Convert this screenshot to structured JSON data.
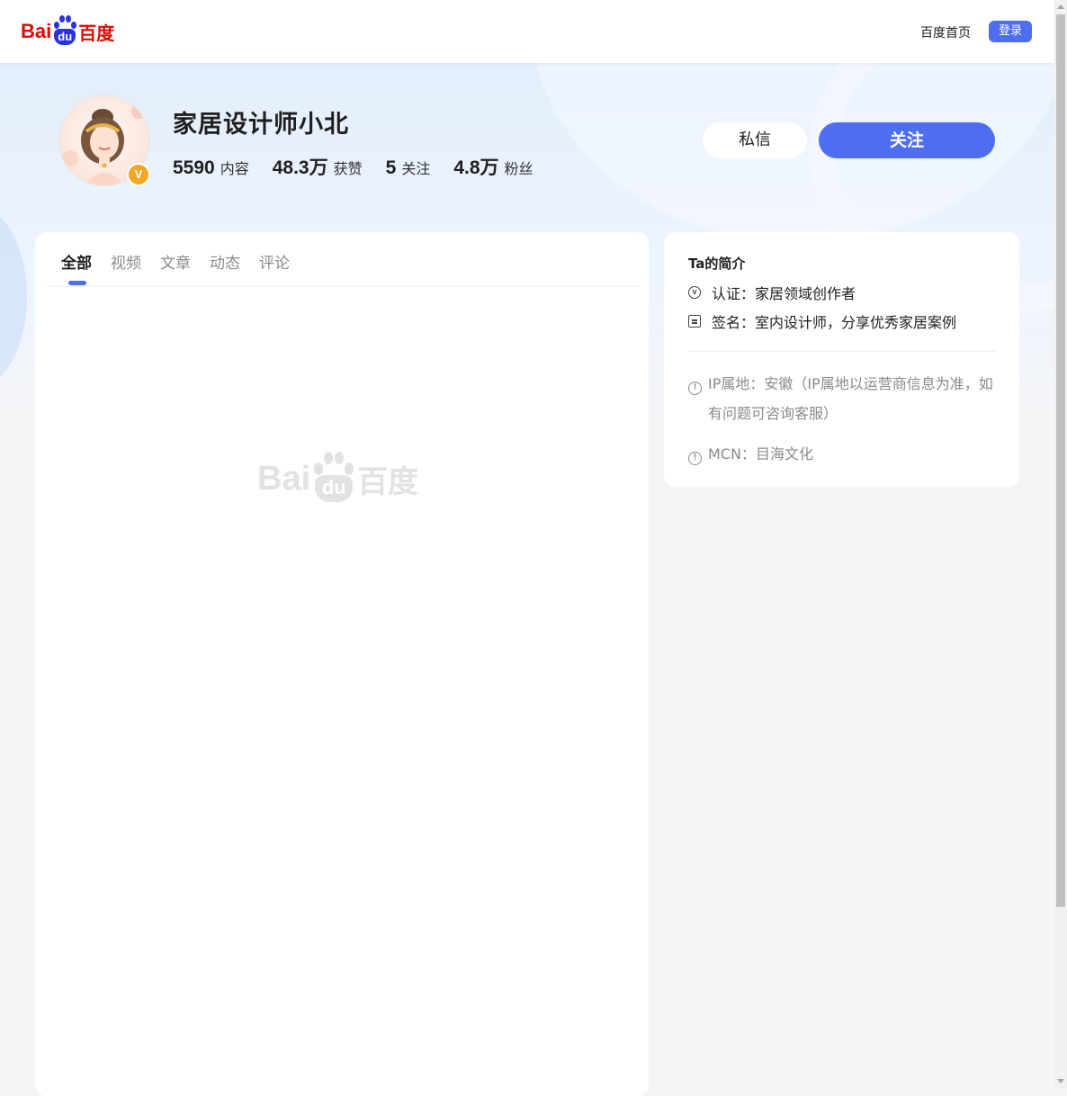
{
  "header": {
    "logo_bai": "Bai",
    "logo_du": "du",
    "logo_cn": "百度",
    "home_link": "百度首页",
    "login_label": "登录"
  },
  "profile": {
    "name": "家居设计师小北",
    "verify_mark": "V",
    "stats": [
      {
        "value": "5590",
        "label": "内容"
      },
      {
        "value": "48.3万",
        "label": "获赞"
      },
      {
        "value": "5",
        "label": "关注"
      },
      {
        "value": "4.8万",
        "label": "粉丝"
      }
    ],
    "message_label": "私信",
    "follow_label": "关注"
  },
  "tabs": [
    {
      "label": "全部",
      "active": true
    },
    {
      "label": "视频",
      "active": false
    },
    {
      "label": "文章",
      "active": false
    },
    {
      "label": "动态",
      "active": false
    },
    {
      "label": "评论",
      "active": false
    }
  ],
  "placeholder": {
    "bai": "Bai",
    "du": "du",
    "cn": "百度"
  },
  "intro": {
    "title": "Ta的简介",
    "certification": "认证：家居领域创作者",
    "signature": "签名：室内设计师，分享优秀家居案例",
    "ip_line1": "IP属地：安徽（IP属地以运营商信息为准，如",
    "ip_line2": "有问题可咨询客服）",
    "mcn": "MCN：目海文化",
    "cert_icon_glyph": "v",
    "warn_icon_glyph": "!"
  },
  "colors": {
    "accent": "#4e6ef2",
    "brand_red": "#e10601",
    "brand_blue": "#2932e1",
    "badge": "#f5a623"
  }
}
